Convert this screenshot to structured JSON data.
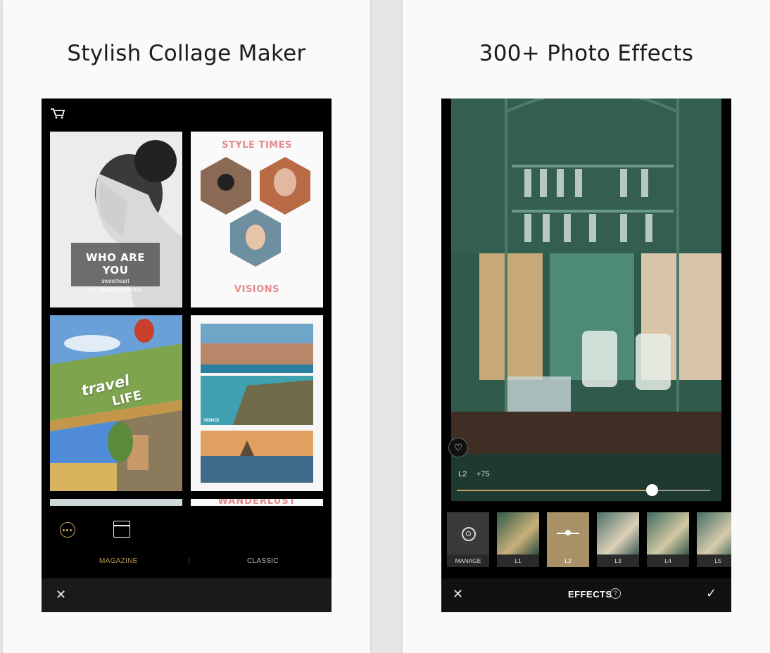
{
  "left_card": {
    "title": "Stylish Collage Maker",
    "tiles": {
      "who_title": "WHO ARE YOU",
      "who_sub1": "sweetheart",
      "who_sub2": "my beautiful princess",
      "style_times": "STYLE TIMES",
      "visions": "VISIONS",
      "travel": "travel",
      "life": "LIFE",
      "venice": "VENICE",
      "wanderlust": "WANDERLUST"
    },
    "tabs": {
      "magazine": "MAGAZINE",
      "separator": "|",
      "classic": "CLASSIC"
    },
    "close": "✕",
    "icons": [
      "cart-icon",
      "more-icon",
      "window-icon",
      "close-icon"
    ]
  },
  "right_card": {
    "title": "300+ Photo Effects",
    "slider": {
      "filter": "L2",
      "value": "+75",
      "fraction": 0.77
    },
    "effects": [
      {
        "label": "MANAGE"
      },
      {
        "label": "L1"
      },
      {
        "label": "L2"
      },
      {
        "label": "L3"
      },
      {
        "label": "L4"
      },
      {
        "label": "L5"
      }
    ],
    "footer": {
      "close": "✕",
      "title": "EFFECTS",
      "help": "?",
      "confirm": "✓"
    },
    "icons": [
      "heart-icon",
      "gear-icon",
      "help-icon",
      "check-icon",
      "close-icon"
    ]
  },
  "colors": {
    "accent_gold": "#c9a45a",
    "pink": "#e48a8a",
    "teal_photo": "#2f5a4c"
  }
}
